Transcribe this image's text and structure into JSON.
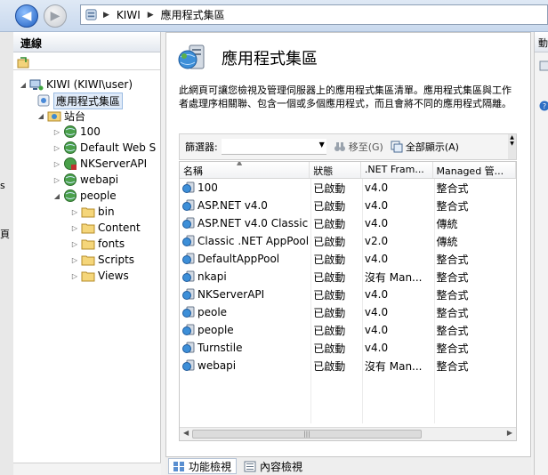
{
  "address": {
    "crumbs": [
      "KIWI",
      "應用程式集區"
    ]
  },
  "left_fragments": [
    "s",
    "頁"
  ],
  "connections": {
    "title": "連線",
    "tree": {
      "server": "KIWI (KIWI\\user)",
      "app_pools": "應用程式集區",
      "sites": "站台",
      "site_100": "100",
      "site_default": "Default Web S",
      "site_nkserver": "NKServerAPI",
      "site_webapi": "webapi",
      "site_people": "people",
      "folder_bin": "bin",
      "folder_content": "Content",
      "folder_fonts": "fonts",
      "folder_scripts": "Scripts",
      "folder_views": "Views"
    }
  },
  "main": {
    "title": "應用程式集區",
    "description": "此網頁可讓您檢視及管理伺服器上的應用程式集區清單。應用程式集區與工作者處理序相關聯、包含一個或多個應用程式，而且會將不同的應用程式隔離。",
    "filter": {
      "label": "篩選器:",
      "go": "移至(G)",
      "show_all": "全部顯示(A)"
    },
    "columns": [
      "名稱",
      "狀態",
      ".NET Fram...",
      "Managed 管..."
    ],
    "rows": [
      {
        "name": "100",
        "status": "已啟動",
        "net": "v4.0",
        "pipeline": "整合式"
      },
      {
        "name": "ASP.NET v4.0",
        "status": "已啟動",
        "net": "v4.0",
        "pipeline": "整合式"
      },
      {
        "name": "ASP.NET v4.0 Classic",
        "status": "已啟動",
        "net": "v4.0",
        "pipeline": "傳統"
      },
      {
        "name": "Classic .NET AppPool",
        "status": "已啟動",
        "net": "v2.0",
        "pipeline": "傳統"
      },
      {
        "name": "DefaultAppPool",
        "status": "已啟動",
        "net": "v4.0",
        "pipeline": "整合式"
      },
      {
        "name": "nkapi",
        "status": "已啟動",
        "net": "沒有 Man...",
        "pipeline": "整合式"
      },
      {
        "name": "NKServerAPI",
        "status": "已啟動",
        "net": "v4.0",
        "pipeline": "整合式"
      },
      {
        "name": "peole",
        "status": "已啟動",
        "net": "v4.0",
        "pipeline": "整合式"
      },
      {
        "name": "people",
        "status": "已啟動",
        "net": "v4.0",
        "pipeline": "整合式"
      },
      {
        "name": "Turnstile",
        "status": "已啟動",
        "net": "v4.0",
        "pipeline": "整合式"
      },
      {
        "name": "webapi",
        "status": "已啟動",
        "net": "沒有 Man...",
        "pipeline": "整合式"
      }
    ]
  },
  "views": {
    "features": "功能檢視",
    "content": "內容檢視"
  },
  "actions": {
    "title_fragment": "動"
  },
  "colors": {
    "accent": "#1f5fc0",
    "selection": "#dfeaf8"
  }
}
